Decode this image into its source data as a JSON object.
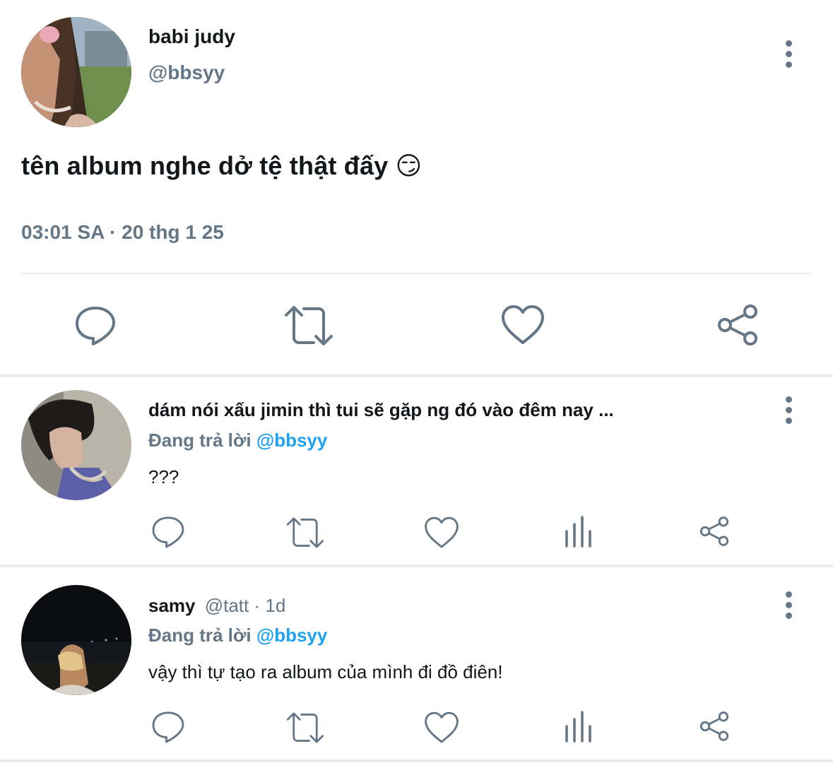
{
  "main_tweet": {
    "display_name": "babi judy",
    "handle": "@bbsyy",
    "text": "tên album nghe dở tệ thật đấy 😏",
    "time": "03:01 SA",
    "dot": "·",
    "date": "20 thg 1 25",
    "actions": [
      "reply-icon",
      "retweet-icon",
      "like-icon",
      "share-icon"
    ]
  },
  "replies": [
    {
      "display_name": "dám nói xấu jimin thì tui sẽ gặp ng đó vào đêm nay ...",
      "handle": "",
      "replying_prefix": "Đang trả lời",
      "replying_to": "@bbsyy",
      "text": "???",
      "actions": [
        "reply-icon",
        "retweet-icon",
        "like-icon",
        "analytics-icon",
        "share-icon"
      ]
    },
    {
      "display_name": "samy",
      "handle": "@tatt · 1d",
      "replying_prefix": "Đang trả lời",
      "replying_to": "@bbsyy",
      "text": "vậy thì tự tạo ra album của mình đi đồ điên!",
      "actions": [
        "reply-icon",
        "retweet-icon",
        "like-icon",
        "analytics-icon",
        "share-icon"
      ]
    }
  ],
  "colors": {
    "text": "#14171a",
    "secondary": "#657786",
    "mention": "#1da1f2",
    "divider": "#e6ecf0"
  }
}
